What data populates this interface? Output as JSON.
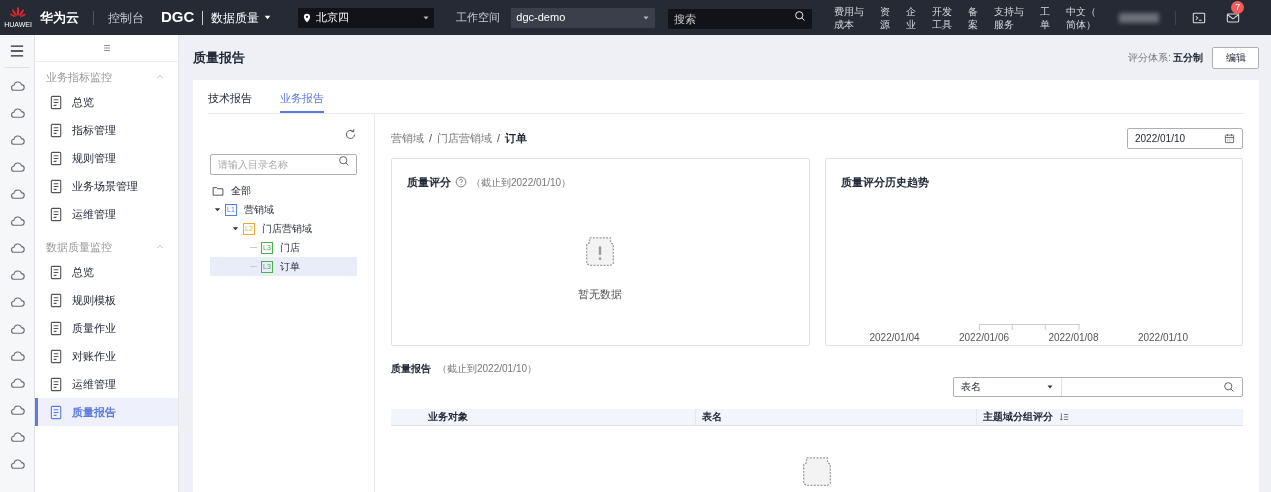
{
  "topbar": {
    "logo_text": "HUAWEI",
    "brand": "华为云",
    "console": "控制台",
    "product": "DGC",
    "module": "数据质量",
    "region": "北京四",
    "workspace_label": "工作空间",
    "workspace": "dgc-demo",
    "search_placeholder": "搜索",
    "links": [
      "费用与成本",
      "资源",
      "企业",
      "开发工具",
      "备案",
      "支持与服务",
      "工单",
      "中文（简体）"
    ],
    "mail_badge": "7"
  },
  "menu": {
    "groups": [
      {
        "title": "业务指标监控",
        "expanded": true,
        "items": [
          {
            "label": "总览",
            "selected": false
          },
          {
            "label": "指标管理",
            "selected": false
          },
          {
            "label": "规则管理",
            "selected": false
          },
          {
            "label": "业务场景管理",
            "selected": false
          },
          {
            "label": "运维管理",
            "selected": false
          }
        ]
      },
      {
        "title": "数据质量监控",
        "expanded": true,
        "items": [
          {
            "label": "总览",
            "selected": false
          },
          {
            "label": "规则模板",
            "selected": false
          },
          {
            "label": "质量作业",
            "selected": false
          },
          {
            "label": "对账作业",
            "selected": false
          },
          {
            "label": "运维管理",
            "selected": false
          },
          {
            "label": "质量报告",
            "selected": true
          }
        ]
      }
    ]
  },
  "page": {
    "title": "质量报告",
    "rating_label": "评分体系:",
    "rating_value": "五分制",
    "edit_button": "编辑"
  },
  "tabs": [
    {
      "label": "技术报告",
      "selected": false
    },
    {
      "label": "业务报告",
      "selected": true
    }
  ],
  "tree": {
    "search_placeholder": "请输入目录名称",
    "nodes": [
      {
        "kind": "folder",
        "label": "全部",
        "selected": false,
        "children": [
          {
            "kind": "level",
            "badge": "L1",
            "color": "#5b7fe0",
            "label": "营销域",
            "expanded": true,
            "selected": false,
            "children": [
              {
                "kind": "level",
                "badge": "L2",
                "color": "#f0a830",
                "label": "门店营销域",
                "expanded": true,
                "selected": false,
                "children": [
                  {
                    "kind": "level",
                    "badge": "L3",
                    "color": "#4caf50",
                    "label": "门店",
                    "selected": false
                  },
                  {
                    "kind": "level",
                    "badge": "L3",
                    "color": "#4caf50",
                    "label": "订单",
                    "selected": true
                  }
                ]
              }
            ]
          }
        ]
      }
    ]
  },
  "breadcrumb": {
    "items": [
      "营销域",
      "门店营销域",
      "订单"
    ],
    "separators": [
      "/",
      "/"
    ]
  },
  "date": "2022/01/10",
  "score_card": {
    "title": "质量评分",
    "note": "（截止到2022/01/10）",
    "empty_text": "暂无数据"
  },
  "trend_card": {
    "title": "质量评分历史趋势",
    "x_labels": [
      "2022/01/04",
      "2022/01/06",
      "2022/01/08",
      "2022/01/10"
    ]
  },
  "report": {
    "title": "质量报告",
    "note": "（截止到2022/01/10）",
    "filter": "表名",
    "columns": [
      {
        "label": "业务对象",
        "sortable": false
      },
      {
        "label": "表名",
        "sortable": false
      },
      {
        "label": "主题域分组评分",
        "sortable": true
      }
    ]
  }
}
